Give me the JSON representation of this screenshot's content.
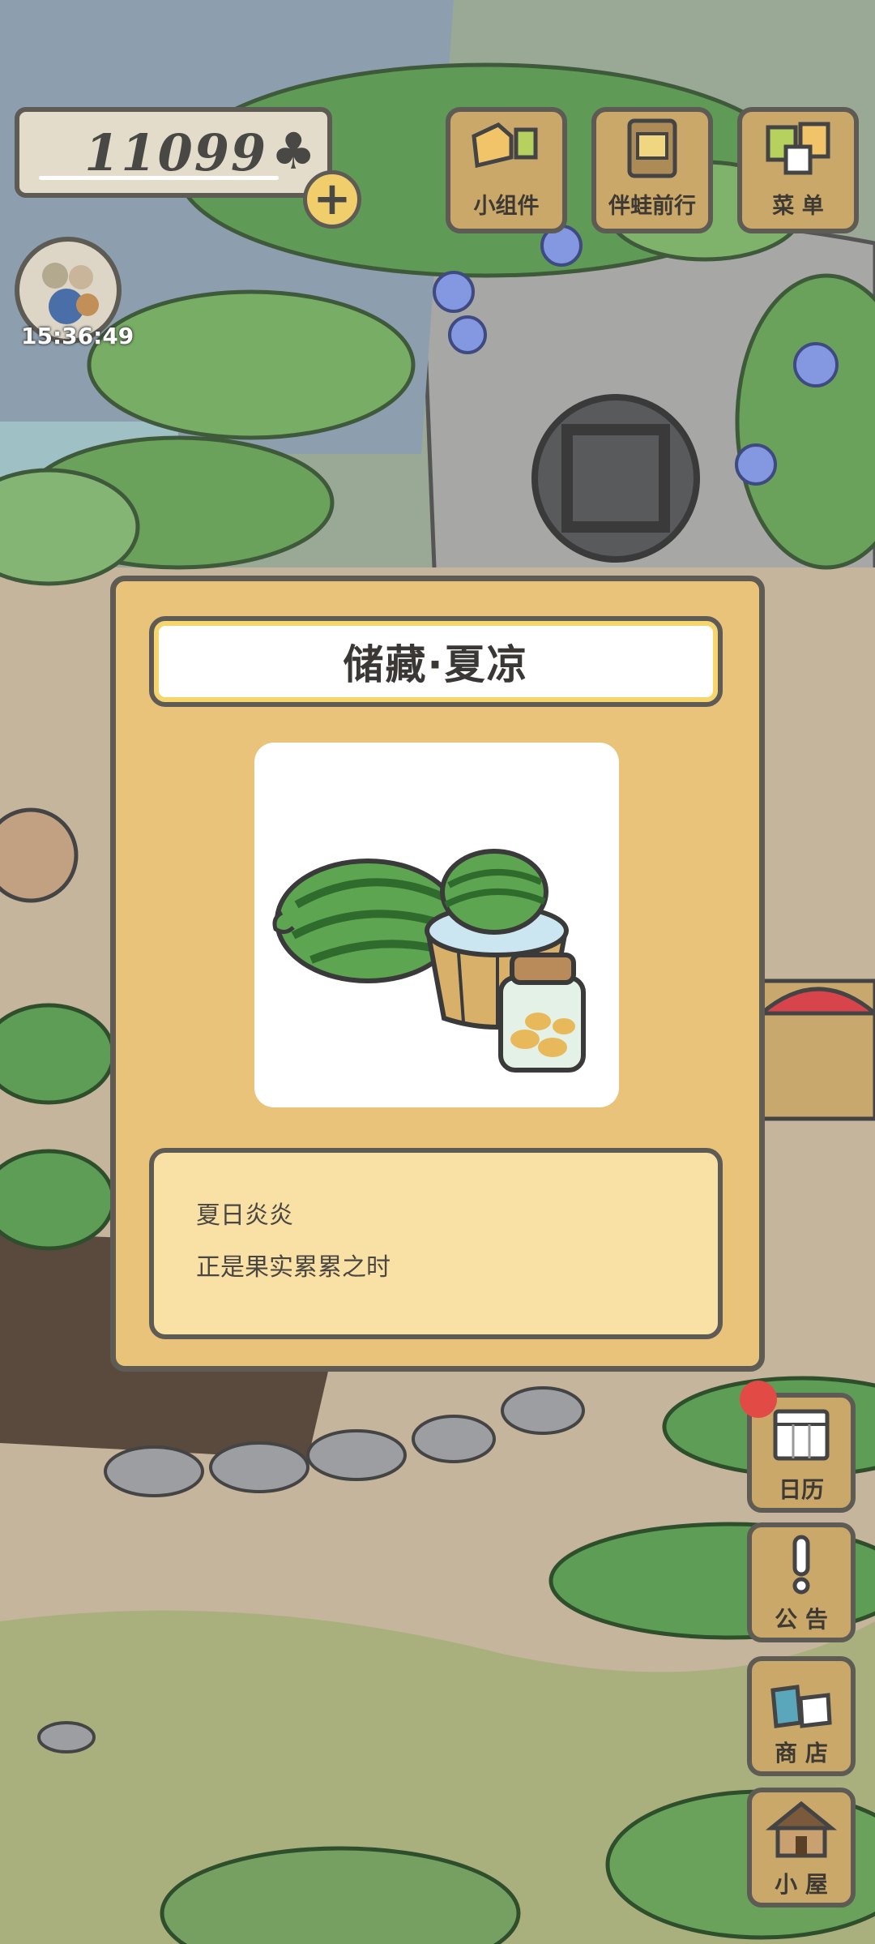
{
  "hud": {
    "clover_count": "11099",
    "clover_icon": "club-icon",
    "add_icon": "plus-icon",
    "visitor_timer": "15:36:49"
  },
  "top_buttons": [
    {
      "label": "小组件",
      "icon": "widget-icon"
    },
    {
      "label": "伴蛙前行",
      "icon": "journey-icon"
    },
    {
      "label": "菜 单",
      "icon": "menu-icon"
    }
  ],
  "side_buttons": [
    {
      "label": "日历",
      "icon": "calendar-icon",
      "has_notification": true
    },
    {
      "label": "公 告",
      "icon": "exclamation-icon"
    },
    {
      "label": "商 店",
      "icon": "shop-bags-icon"
    },
    {
      "label": "小 屋",
      "icon": "house-icon"
    }
  ],
  "dialog": {
    "title": "储藏·夏凉",
    "item_image": "watermelon-bucket-jar",
    "description_lines": [
      "夏日炎炎",
      "正是果实累累之时"
    ]
  },
  "colors": {
    "panel": "#e9c37a",
    "outline": "#5e5b55",
    "desc_bg": "#f9e0a4",
    "button_wood": "#c9a86a",
    "badge": "#e24b45"
  }
}
